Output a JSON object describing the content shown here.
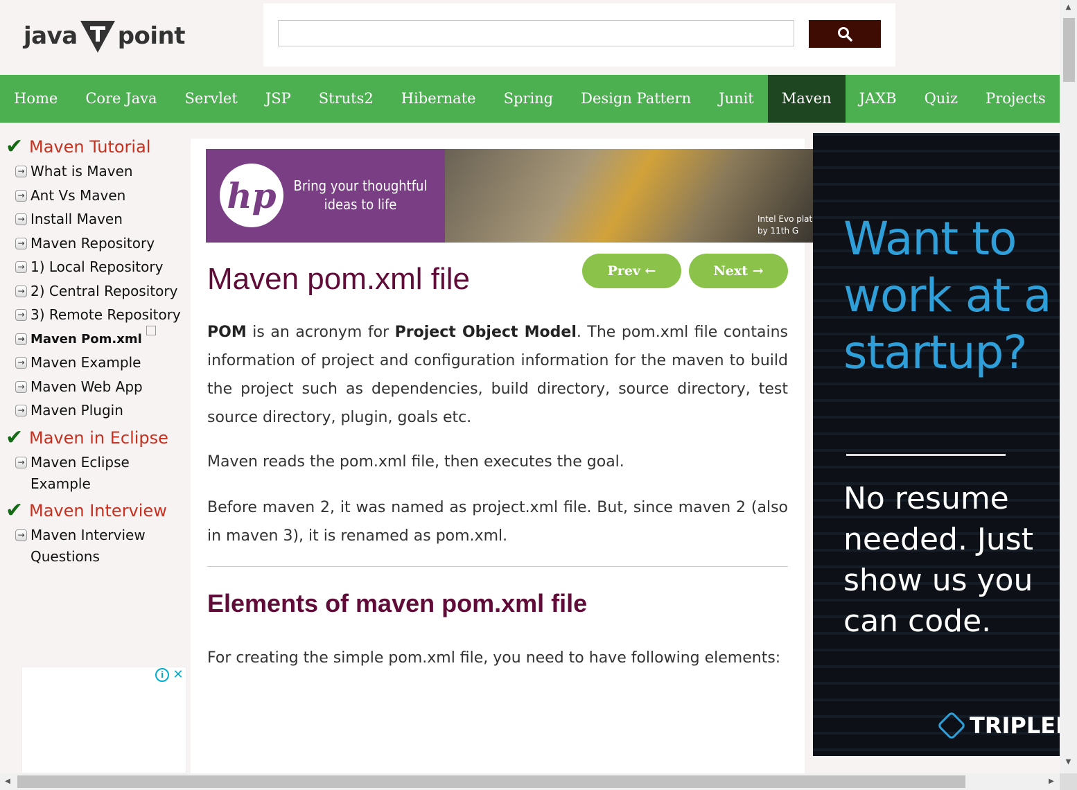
{
  "logo": {
    "left": "java",
    "right": "point"
  },
  "search": {
    "value": "",
    "placeholder": ""
  },
  "nav": {
    "items": [
      "Home",
      "Core Java",
      "Servlet",
      "JSP",
      "Struts2",
      "Hibernate",
      "Spring",
      "Design Pattern",
      "Junit",
      "Maven",
      "JAXB",
      "Quiz",
      "Projects"
    ],
    "active": "Maven"
  },
  "sidebar": {
    "sections": [
      {
        "header": "Maven Tutorial",
        "items": [
          "What is Maven",
          "Ant Vs Maven",
          "Install Maven",
          "Maven Repository",
          "1) Local Repository",
          "2) Central Repository",
          "3) Remote Repository",
          "Maven Pom.xml",
          "Maven Example",
          "Maven Web App",
          "Maven Plugin"
        ]
      },
      {
        "header": "Maven in Eclipse",
        "items": [
          "Maven Eclipse Example"
        ]
      },
      {
        "header": "Maven Interview",
        "items": [
          "Maven Interview Questions"
        ]
      }
    ],
    "current": "Maven Pom.xml"
  },
  "banner": {
    "brand": "hp",
    "text": "Bring your thoughtful ideas to life",
    "small_line1": "Intel Evo plat",
    "small_line2": "by 11th G"
  },
  "main": {
    "title": "Maven pom.xml file",
    "prev_label": "Prev ←",
    "next_label": "Next →",
    "p1_b1": "POM",
    "p1_t1": " is an acronym for ",
    "p1_b2": "Project Object Model",
    "p1_t2": ". The pom.xml file contains information of project and configuration information for the maven to build the project such as dependencies, build directory, source directory, test source directory, plugin, goals etc.",
    "p2": "Maven reads the pom.xml file, then executes the goal.",
    "p3": "Before maven 2, it was named as project.xml file. But, since maven 2 (also in maven 3), it is renamed as pom.xml.",
    "subtitle": "Elements of maven pom.xml file",
    "p4": "For creating the simple pom.xml file, you need to have following elements:"
  },
  "right_ad": {
    "headline": "Want to work at a startup?",
    "body": "No resume needed. Just show us you can code.",
    "brand": "TRIPLEB"
  },
  "side_ad": {
    "info": "i",
    "close": "✕"
  },
  "colors": {
    "nav": "#4caf50",
    "nav_active": "#1e4620",
    "title": "#610b38",
    "side_header": "#c7301e",
    "button": "#8bc34a",
    "search_btn": "#3e0c03"
  }
}
